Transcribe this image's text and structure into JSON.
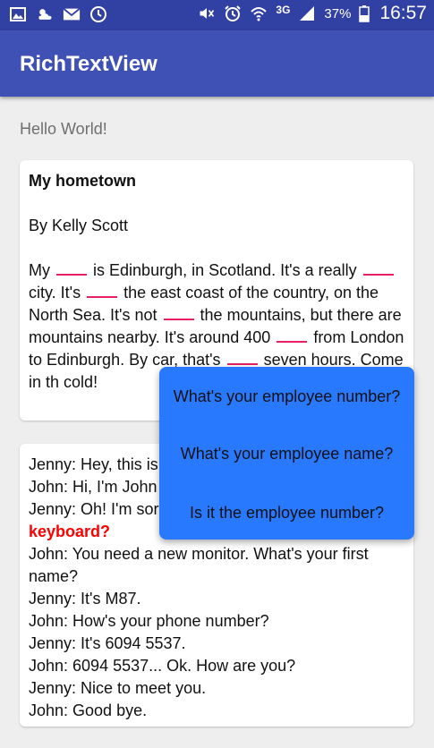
{
  "status_bar": {
    "battery": "37%",
    "network": "3G",
    "time": "16:57",
    "icons_left": [
      "gallery-icon",
      "weather-icon",
      "mail-icon",
      "timer-icon"
    ],
    "icons_right": [
      "mute-icon",
      "alarm-icon",
      "wifi-icon",
      "signal-icon",
      "battery-icon"
    ]
  },
  "app_bar": {
    "title": "RichTextView"
  },
  "main": {
    "hello": "Hello World!"
  },
  "card1": {
    "heading": "My hometown",
    "byline": "By Kelly Scott",
    "p1": "My",
    "p2": "is Edinburgh, in Scotland. It's a really",
    "p3": "city. It's",
    "p4": "the east coast of the country, on the North Sea. It's not",
    "p5": "the mountains, but there are mountains nearby. It's around 400",
    "p6": "from London to Edinburgh. By car, that's",
    "p7": "seven hours. Come in th",
    "p8": "cold!"
  },
  "card2": {
    "l1": "Jenny: Hey, this is",
    "l2": "John: Hi, I'm John",
    "l3": "Jenny: Oh! I'm sor",
    "l4": "keyboard?",
    "l5": "John: You need a new monitor. What's your first name?",
    "l6": "Jenny: It's M87.",
    "l7": "John: How's your phone number?",
    "l8": "Jenny: It's 6094 5537.",
    "l9": "John: 6094 5537... Ok. How are you?",
    "l10": "Jenny: Nice to meet you.",
    "l11": "John: Good bye."
  },
  "popup": {
    "options": [
      "What's your employee number?",
      "What's your employee name?",
      "Is it the employee number?"
    ]
  },
  "colors": {
    "status_bar": "#3140a3",
    "app_bar": "#3f51b5",
    "popup": "#2979ff",
    "blank_underline": "#e91e63",
    "highlight": "#ff0000"
  }
}
